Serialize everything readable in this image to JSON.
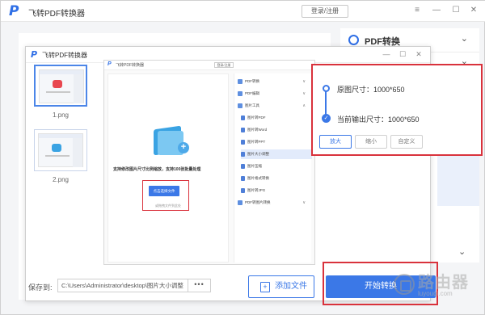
{
  "app": {
    "logo": "P",
    "title": "飞转PDF转换器",
    "login": "登录/注册",
    "controls": [
      "≡",
      "—",
      "☐",
      "✕"
    ]
  },
  "sidebar": {
    "header": "PDF转换",
    "chevrons": [
      "⌄",
      "⌄",
      "⌃",
      "⌄"
    ]
  },
  "inner_window": {
    "logo": "P",
    "title": "飞转PDF转换器",
    "controls": [
      "—",
      "☐",
      "✕"
    ]
  },
  "thumbnails": [
    {
      "label": "1.png",
      "selected": true,
      "blob_color": "#e8474f"
    },
    {
      "label": "2.png",
      "selected": false,
      "blob_color": "#3aa3e3"
    }
  ],
  "preview": {
    "logo": "P",
    "title": "飞转PDF转换器",
    "login": "登录/注册",
    "description": "支持修改图片尺寸比例缩放，支持100张批量处理",
    "add_button": "点击选择文件",
    "hint": "或拖拽文件到此处",
    "side_items": [
      {
        "label": "PDF转换",
        "sub": false,
        "chev": "∨",
        "active": false
      },
      {
        "label": "PDF编辑",
        "sub": false,
        "chev": "∨",
        "active": false
      },
      {
        "label": "图片工具",
        "sub": false,
        "chev": "∧",
        "active": false
      },
      {
        "label": "图片转PDF",
        "sub": true,
        "chev": "",
        "active": false
      },
      {
        "label": "图片转Word",
        "sub": true,
        "chev": "",
        "active": false
      },
      {
        "label": "图片转PPT",
        "sub": true,
        "chev": "",
        "active": false
      },
      {
        "label": "图片大小调整",
        "sub": true,
        "chev": "",
        "active": true
      },
      {
        "label": "图片压缩",
        "sub": true,
        "chev": "",
        "active": false
      },
      {
        "label": "图片格式转换",
        "sub": true,
        "chev": "",
        "active": false
      },
      {
        "label": "图片转JPG",
        "sub": true,
        "chev": "",
        "active": false
      },
      {
        "label": "PDF转图片转换",
        "sub": false,
        "chev": "∨",
        "active": false
      }
    ]
  },
  "size_panel": {
    "original": "原图尺寸：1000*650",
    "output": "当前输出尺寸：1000*650",
    "check": "✓",
    "buttons": [
      "放大",
      "缩小",
      "自定义"
    ]
  },
  "bottom": {
    "save_label": "保存到:",
    "save_path": "C:\\Users\\Administrator\\desktop\\图片大小调整",
    "more": "•••",
    "add_file_icon": "+",
    "add_file": "添加文件",
    "start": "开始转换"
  },
  "watermark": {
    "text": "路由器",
    "sub": "luyouqi.com"
  },
  "colors": {
    "accent": "#3b78e7",
    "highlight_red": "#d9323c"
  }
}
